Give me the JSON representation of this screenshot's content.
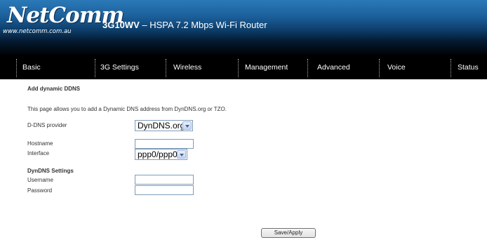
{
  "header": {
    "logo_text": "NetComm",
    "logo_url": "www.netcomm.com.au",
    "model": "3G10WV",
    "product_desc": " – HSPA 7.2 Mbps Wi-Fi Router"
  },
  "nav": {
    "items": [
      {
        "label": "Basic"
      },
      {
        "label": "3G Settings"
      },
      {
        "label": "Wireless"
      },
      {
        "label": "Management"
      },
      {
        "label": "Advanced"
      },
      {
        "label": "Voice"
      },
      {
        "label": "Status"
      }
    ]
  },
  "page": {
    "title": "Add dynamic DDNS",
    "description": "This page allows you to add a Dynamic DNS address from DynDNS.org or TZO.",
    "ddns_provider_label": "D-DNS provider",
    "ddns_provider_value": "DynDNS.org",
    "hostname_label": "Hostname",
    "hostname_value": "",
    "interface_label": "Interface",
    "interface_value": "ppp0/ppp0",
    "dyndns_settings_heading": "DynDNS Settings",
    "username_label": "Username",
    "username_value": "",
    "password_label": "Password",
    "password_value": "",
    "save_button_label": "Save/Apply"
  }
}
